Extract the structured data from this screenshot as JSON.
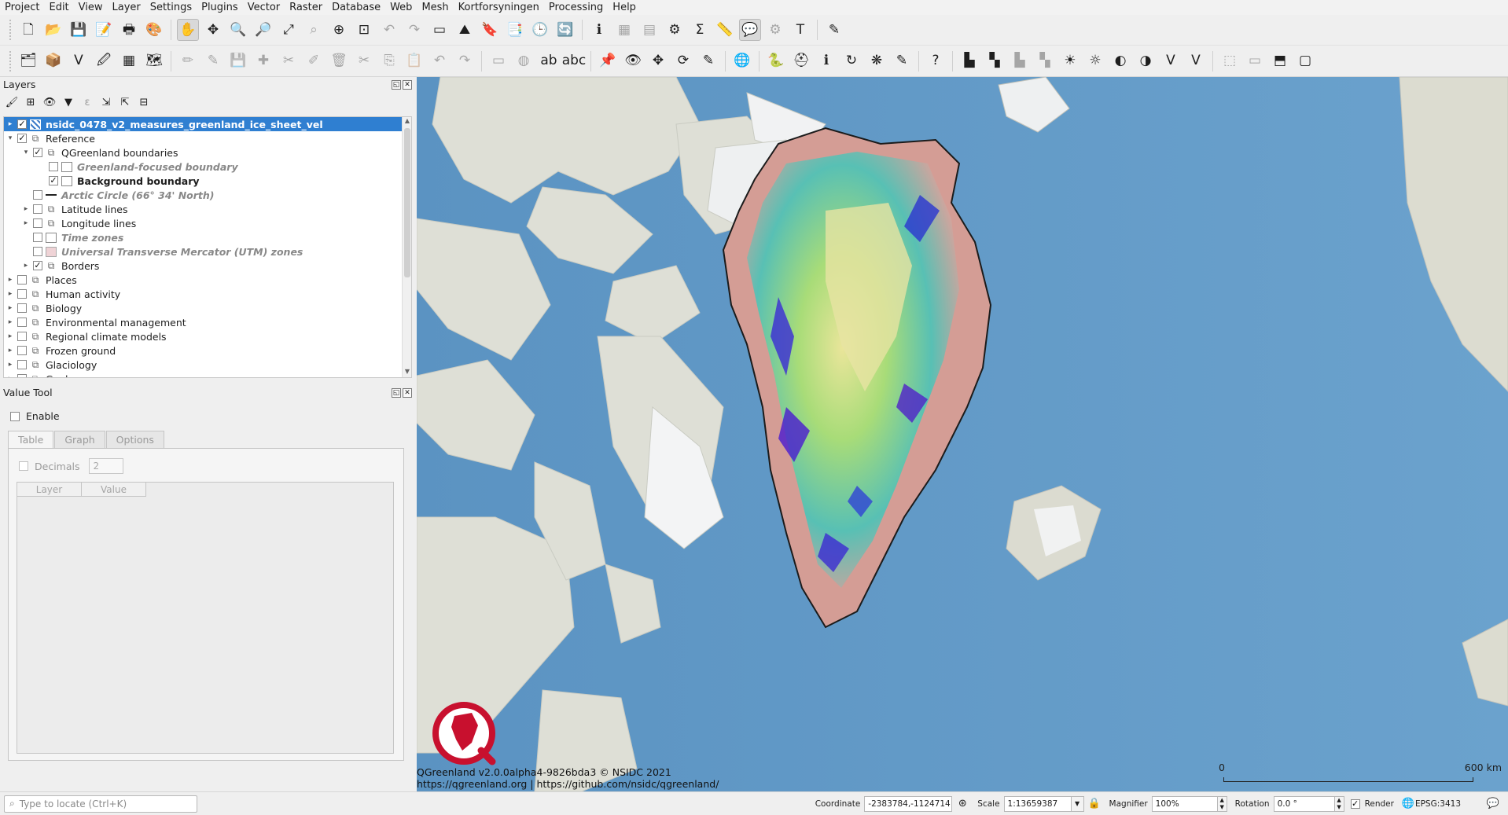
{
  "menu": [
    "Project",
    "Edit",
    "View",
    "Layer",
    "Settings",
    "Plugins",
    "Vector",
    "Raster",
    "Database",
    "Web",
    "Mesh",
    "Kortforsyningen",
    "Processing",
    "Help"
  ],
  "toolbar1": [
    {
      "name": "new-project-icon",
      "glyph": "🗋"
    },
    {
      "name": "open-project-icon",
      "glyph": "📂"
    },
    {
      "name": "save-project-icon",
      "glyph": "💾"
    },
    {
      "name": "save-as-icon",
      "glyph": "📝"
    },
    {
      "name": "print-layout-icon",
      "glyph": "🖶"
    },
    {
      "name": "style-manager-icon",
      "glyph": "🎨"
    },
    {
      "sep": true
    },
    {
      "name": "pan-map-icon",
      "glyph": "✋",
      "active": true
    },
    {
      "name": "pan-to-selection-icon",
      "glyph": "✥"
    },
    {
      "name": "zoom-in-icon",
      "glyph": "🔍"
    },
    {
      "name": "zoom-out-icon",
      "glyph": "🔎"
    },
    {
      "name": "zoom-full-icon",
      "glyph": "⤢"
    },
    {
      "name": "zoom-to-selection-icon",
      "glyph": "⌕",
      "dim": true
    },
    {
      "name": "zoom-to-layer-icon",
      "glyph": "⊕"
    },
    {
      "name": "zoom-native-icon",
      "glyph": "⊡"
    },
    {
      "name": "zoom-last-icon",
      "glyph": "↶",
      "dim": true
    },
    {
      "name": "zoom-next-icon",
      "glyph": "↷",
      "dim": true
    },
    {
      "name": "new-map-view-icon",
      "glyph": "▭"
    },
    {
      "name": "new-3d-view-icon",
      "glyph": "⛰"
    },
    {
      "name": "new-bookmark-icon",
      "glyph": "🔖"
    },
    {
      "name": "show-bookmarks-icon",
      "glyph": "📑"
    },
    {
      "name": "temporal-controller-icon",
      "glyph": "🕒"
    },
    {
      "name": "refresh-icon",
      "glyph": "🔄"
    },
    {
      "sep": true
    },
    {
      "name": "identify-icon",
      "glyph": "ℹ"
    },
    {
      "name": "attribute-table-icon",
      "glyph": "▦",
      "dim": true
    },
    {
      "name": "field-calculator-icon",
      "glyph": "▤",
      "dim": true
    },
    {
      "name": "toolbox-icon",
      "glyph": "⚙"
    },
    {
      "name": "statistics-icon",
      "glyph": "Σ"
    },
    {
      "name": "measure-icon",
      "glyph": "📏"
    },
    {
      "name": "map-tips-icon",
      "glyph": "💬",
      "active": true
    },
    {
      "name": "settings-gear-icon",
      "glyph": "⚙",
      "dim": true
    },
    {
      "name": "text-annotation-icon",
      "glyph": "T"
    },
    {
      "sep": true
    },
    {
      "name": "digitize-icon",
      "glyph": "✎"
    }
  ],
  "toolbar2": [
    {
      "name": "data-source-manager-icon",
      "glyph": "🗂"
    },
    {
      "name": "add-layer-icon",
      "glyph": "📦"
    },
    {
      "name": "add-vector-icon",
      "glyph": "V"
    },
    {
      "name": "add-raster-icon",
      "glyph": "🖉"
    },
    {
      "name": "add-mesh-icon",
      "glyph": "▦"
    },
    {
      "name": "new-geopackage-icon",
      "glyph": "🗺"
    },
    {
      "sep": true
    },
    {
      "name": "current-edits-icon",
      "glyph": "✏",
      "dim": true
    },
    {
      "name": "toggle-editing-icon",
      "glyph": "✎",
      "dim": true
    },
    {
      "name": "save-edits-icon",
      "glyph": "💾",
      "dim": true
    },
    {
      "name": "add-feature-icon",
      "glyph": "✚",
      "dim": true
    },
    {
      "name": "vertex-tool-icon",
      "glyph": "✂",
      "dim": true
    },
    {
      "name": "modify-attributes-icon",
      "glyph": "✐",
      "dim": true
    },
    {
      "name": "delete-selected-icon",
      "glyph": "🗑",
      "dim": true
    },
    {
      "name": "cut-features-icon",
      "glyph": "✂",
      "dim": true
    },
    {
      "name": "copy-features-icon",
      "glyph": "⎘",
      "dim": true
    },
    {
      "name": "paste-features-icon",
      "glyph": "📋",
      "dim": true
    },
    {
      "name": "undo-icon",
      "glyph": "↶",
      "dim": true
    },
    {
      "name": "redo-icon",
      "glyph": "↷",
      "dim": true
    },
    {
      "sep": true
    },
    {
      "name": "label-toolbar-icon",
      "glyph": "▭",
      "dim": true
    },
    {
      "name": "diagram-icon",
      "glyph": "◍",
      "dim": true
    },
    {
      "name": "label-ab-icon",
      "glyph": "ab"
    },
    {
      "name": "label-abc-icon",
      "glyph": "abc"
    },
    {
      "sep": true
    },
    {
      "name": "pin-label-icon",
      "glyph": "📌"
    },
    {
      "name": "show-label-icon",
      "glyph": "👁"
    },
    {
      "name": "move-label-icon",
      "glyph": "✥"
    },
    {
      "name": "rotate-label-icon",
      "glyph": "⟳"
    },
    {
      "name": "change-label-icon",
      "glyph": "✎"
    },
    {
      "sep": true
    },
    {
      "name": "plugin-globe-icon",
      "glyph": "🌐"
    },
    {
      "sep": true
    },
    {
      "name": "python-console-icon",
      "glyph": "🐍"
    },
    {
      "name": "help-lifebuoy-icon",
      "glyph": "⛑"
    },
    {
      "name": "info-plugin-icon",
      "glyph": "ℹ"
    },
    {
      "name": "reload-plugin-icon",
      "glyph": "↻"
    },
    {
      "name": "mosaic-icon",
      "glyph": "❋"
    },
    {
      "name": "pencil-plugin-icon",
      "glyph": "✎"
    },
    {
      "sep": true
    },
    {
      "name": "whats-this-icon",
      "glyph": "?"
    },
    {
      "sep": true
    },
    {
      "name": "histogram-icon",
      "glyph": "▙"
    },
    {
      "name": "stretch-icon",
      "glyph": "▚"
    },
    {
      "name": "stretch-dim-icon",
      "glyph": "▙",
      "dim": true
    },
    {
      "name": "local-histogram-icon",
      "glyph": "▚",
      "dim": true
    },
    {
      "name": "brightness-up-icon",
      "glyph": "☀"
    },
    {
      "name": "brightness-down-icon",
      "glyph": "☼"
    },
    {
      "name": "contrast-up-icon",
      "glyph": "◐"
    },
    {
      "name": "contrast-down-icon",
      "glyph": "◑"
    },
    {
      "name": "select-vector-icon",
      "glyph": "V"
    },
    {
      "name": "select-vector-b-icon",
      "glyph": "V"
    },
    {
      "sep": true
    },
    {
      "name": "select-features-icon",
      "glyph": "⬚",
      "dim": true
    },
    {
      "name": "deselect-icon",
      "glyph": "▭",
      "dim": true
    },
    {
      "name": "select-by-value-icon",
      "glyph": "⬒"
    },
    {
      "name": "select-rect-icon",
      "glyph": "▢"
    }
  ],
  "layers_panel": {
    "title": "Layers",
    "toolbar": [
      {
        "name": "open-styling-icon",
        "glyph": "🖌"
      },
      {
        "name": "add-group-icon",
        "glyph": "⊞"
      },
      {
        "name": "manage-themes-icon",
        "glyph": "👁"
      },
      {
        "name": "filter-legend-icon",
        "glyph": "▼"
      },
      {
        "name": "filter-expression-icon",
        "glyph": "ε",
        "dim": true
      },
      {
        "name": "expand-all-icon",
        "glyph": "⇲"
      },
      {
        "name": "collapse-all-icon",
        "glyph": "⇱"
      },
      {
        "name": "remove-layer-icon",
        "glyph": "⊟"
      }
    ],
    "rows": [
      {
        "label": "nsidc_0478_v2_measures_greenland_ice_sheet_vel",
        "indent": 0,
        "arrow": "▸",
        "checked": true,
        "sym": "raster",
        "style": "bold",
        "selected": true
      },
      {
        "label": "Reference",
        "indent": 0,
        "arrow": "▾",
        "checked": true,
        "sym": "group"
      },
      {
        "label": "QGreenland boundaries",
        "indent": 1,
        "arrow": "▾",
        "checked": true,
        "sym": "group"
      },
      {
        "label": "Greenland-focused boundary",
        "indent": 2,
        "arrow": "",
        "checked": false,
        "sym": "box",
        "style": "italic"
      },
      {
        "label": "Background boundary",
        "indent": 2,
        "arrow": "",
        "checked": true,
        "sym": "box",
        "style": "bold"
      },
      {
        "label": "Arctic Circle (66° 34' North)",
        "indent": 1,
        "arrow": "",
        "checked": false,
        "sym": "line",
        "style": "italic"
      },
      {
        "label": "Latitude lines",
        "indent": 1,
        "arrow": "▸",
        "checked": false,
        "sym": "group"
      },
      {
        "label": "Longitude lines",
        "indent": 1,
        "arrow": "▸",
        "checked": false,
        "sym": "group"
      },
      {
        "label": "Time zones",
        "indent": 1,
        "arrow": "",
        "checked": false,
        "sym": "box",
        "style": "italic"
      },
      {
        "label": "Universal Transverse Mercator (UTM) zones",
        "indent": 1,
        "arrow": "",
        "checked": false,
        "sym": "pink",
        "style": "italic"
      },
      {
        "label": "Borders",
        "indent": 1,
        "arrow": "▸",
        "checked": true,
        "sym": "group"
      },
      {
        "label": "Places",
        "indent": 0,
        "arrow": "▸",
        "checked": false,
        "sym": "group"
      },
      {
        "label": "Human activity",
        "indent": 0,
        "arrow": "▸",
        "checked": false,
        "sym": "group"
      },
      {
        "label": "Biology",
        "indent": 0,
        "arrow": "▸",
        "checked": false,
        "sym": "group"
      },
      {
        "label": "Environmental management",
        "indent": 0,
        "arrow": "▸",
        "checked": false,
        "sym": "group"
      },
      {
        "label": "Regional climate models",
        "indent": 0,
        "arrow": "▸",
        "checked": false,
        "sym": "group"
      },
      {
        "label": "Frozen ground",
        "indent": 0,
        "arrow": "▸",
        "checked": false,
        "sym": "group"
      },
      {
        "label": "Glaciology",
        "indent": 0,
        "arrow": "▸",
        "checked": false,
        "sym": "group"
      },
      {
        "label": "Geology",
        "indent": 0,
        "arrow": "▸",
        "checked": false,
        "sym": "group"
      }
    ]
  },
  "value_tool": {
    "title": "Value Tool",
    "enable_label": "Enable",
    "tabs": [
      "Table",
      "Graph",
      "Options"
    ],
    "decimals_label": "Decimals",
    "decimals_value": "2",
    "columns": [
      "Layer",
      "Value"
    ]
  },
  "map": {
    "attribution_line1": "QGreenland v2.0.0alpha4-9826bda3 © NSIDC 2021",
    "attribution_line2": "https://qgreenland.org | https://github.com/nsidc/qgreenland/",
    "scale_start": "0",
    "scale_end": "600 km",
    "colors": {
      "ocean": "#5f98c6",
      "land": "#dcdcd2",
      "ice": "#f4f6f8",
      "logo": "#c8102e"
    }
  },
  "statusbar": {
    "locate_placeholder": "Type to locate (Ctrl+K)",
    "coordinate_label": "Coordinate",
    "coordinate_value": "-2383784,-1124714",
    "scale_label": "Scale",
    "scale_value": "1:13659387",
    "magnifier_label": "Magnifier",
    "magnifier_value": "100%",
    "rotation_label": "Rotation",
    "rotation_value": "0.0 °",
    "render_label": "Render",
    "render_checked": true,
    "crs_label": "EPSG:3413"
  }
}
